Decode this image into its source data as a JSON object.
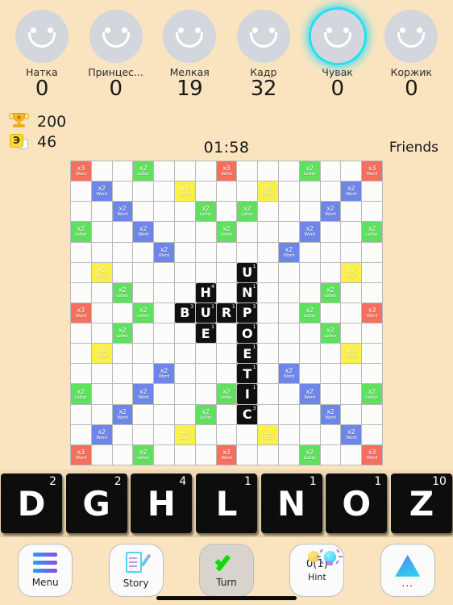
{
  "header": {
    "players": [
      {
        "name": "Натка",
        "score": "0",
        "active": false
      },
      {
        "name": "Принцес...",
        "score": "0",
        "active": false
      },
      {
        "name": "Мелкая",
        "score": "19",
        "active": false
      },
      {
        "name": "Кадр",
        "score": "32",
        "active": false
      },
      {
        "name": "Чувак",
        "score": "0",
        "active": true
      },
      {
        "name": "Коржик",
        "score": "0",
        "active": false
      }
    ],
    "trophy_icon": "trophy-icon",
    "trophy_value": "200",
    "bag_icon": "tile-bag-icon",
    "bag_letter": "Э",
    "bag_value": "46",
    "timer": "01:58",
    "mode": "Friends",
    "active_highlight_color": "#25E0F2"
  },
  "board": {
    "size": 15,
    "legend": {
      "w3": {
        "multiplier": "x3",
        "kind": "Word",
        "color": "#F4705C"
      },
      "w2": {
        "multiplier": "x2",
        "kind": "Word",
        "color": "#6E86E8"
      },
      "l3": {
        "multiplier": "x3",
        "kind": "Letter",
        "color": "#FBF04A"
      },
      "l2": {
        "multiplier": "x2",
        "kind": "Letter",
        "color": "#5FE05F"
      }
    },
    "premium": [
      [
        "w3",
        "",
        "",
        "l2",
        "",
        "",
        "",
        "w3",
        "",
        "",
        "",
        "l2",
        "",
        "",
        "w3"
      ],
      [
        "",
        "w2",
        "",
        "",
        "",
        "l3",
        "",
        "",
        "",
        "l3",
        "",
        "",
        "",
        "w2",
        ""
      ],
      [
        "",
        "",
        "w2",
        "",
        "",
        "",
        "l2",
        "",
        "l2",
        "",
        "",
        "",
        "w2",
        "",
        ""
      ],
      [
        "l2",
        "",
        "",
        "w2",
        "",
        "",
        "",
        "l2",
        "",
        "",
        "",
        "w2",
        "",
        "",
        "l2"
      ],
      [
        "",
        "",
        "",
        "",
        "w2",
        "",
        "",
        "",
        "",
        "",
        "w2",
        "",
        "",
        "",
        ""
      ],
      [
        "",
        "l3",
        "",
        "",
        "",
        "",
        "",
        "",
        "",
        "",
        "",
        "",
        "",
        "l3",
        ""
      ],
      [
        "",
        "",
        "l2",
        "",
        "",
        "",
        "",
        "",
        "",
        "",
        "",
        "",
        "l2",
        "",
        ""
      ],
      [
        "w3",
        "",
        "",
        "l2",
        "",
        "",
        "",
        "",
        "",
        "",
        "",
        "l2",
        "",
        "",
        "w3"
      ],
      [
        "",
        "",
        "l2",
        "",
        "",
        "",
        "",
        "",
        "",
        "",
        "",
        "",
        "l2",
        "",
        ""
      ],
      [
        "",
        "l3",
        "",
        "",
        "",
        "",
        "",
        "",
        "",
        "",
        "",
        "",
        "",
        "l3",
        ""
      ],
      [
        "",
        "",
        "",
        "",
        "w2",
        "",
        "",
        "",
        "",
        "",
        "w2",
        "",
        "",
        "",
        ""
      ],
      [
        "l2",
        "",
        "",
        "w2",
        "",
        "",
        "",
        "l2",
        "",
        "",
        "",
        "w2",
        "",
        "",
        "l2"
      ],
      [
        "",
        "",
        "w2",
        "",
        "",
        "",
        "l2",
        "",
        "l2",
        "",
        "",
        "",
        "w2",
        "",
        ""
      ],
      [
        "",
        "w2",
        "",
        "",
        "",
        "l3",
        "",
        "",
        "",
        "l3",
        "",
        "",
        "",
        "w2",
        ""
      ],
      [
        "w3",
        "",
        "",
        "l2",
        "",
        "",
        "",
        "w3",
        "",
        "",
        "",
        "l2",
        "",
        "",
        "w3"
      ]
    ],
    "tiles": [
      {
        "row": 5,
        "col": 8,
        "letter": "U",
        "points": "1"
      },
      {
        "row": 6,
        "col": 6,
        "letter": "H",
        "points": "4"
      },
      {
        "row": 6,
        "col": 8,
        "letter": "N",
        "points": "1"
      },
      {
        "row": 7,
        "col": 5,
        "letter": "B",
        "points": "3"
      },
      {
        "row": 7,
        "col": 6,
        "letter": "U",
        "points": "1"
      },
      {
        "row": 7,
        "col": 7,
        "letter": "R",
        "points": "1"
      },
      {
        "row": 7,
        "col": 8,
        "letter": "P",
        "points": "3"
      },
      {
        "row": 8,
        "col": 6,
        "letter": "E",
        "points": "1"
      },
      {
        "row": 8,
        "col": 8,
        "letter": "O",
        "points": "1"
      },
      {
        "row": 9,
        "col": 8,
        "letter": "E",
        "points": "1"
      },
      {
        "row": 10,
        "col": 8,
        "letter": "T",
        "points": "1"
      },
      {
        "row": 11,
        "col": 8,
        "letter": "I",
        "points": "1"
      },
      {
        "row": 12,
        "col": 8,
        "letter": "C",
        "points": "3"
      }
    ]
  },
  "rack": {
    "tiles": [
      {
        "letter": "D",
        "points": "2"
      },
      {
        "letter": "G",
        "points": "2"
      },
      {
        "letter": "H",
        "points": "4"
      },
      {
        "letter": "L",
        "points": "1"
      },
      {
        "letter": "N",
        "points": "1"
      },
      {
        "letter": "O",
        "points": "1"
      },
      {
        "letter": "Z",
        "points": "10"
      }
    ]
  },
  "toolbar": {
    "menu_label": "Menu",
    "story_label": "Story",
    "turn_label": "Turn",
    "hint_count": "0(1)",
    "hint_label": "Hint",
    "more_label": "..."
  }
}
